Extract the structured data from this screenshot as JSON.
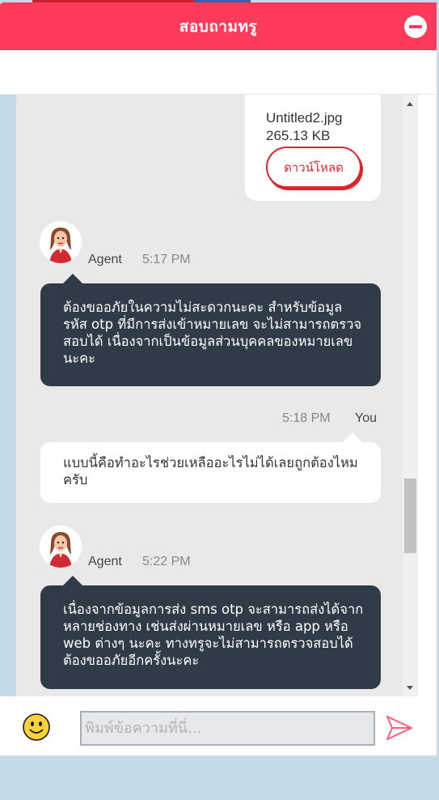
{
  "header": {
    "title": "สอบถามทรู"
  },
  "file": {
    "name": "Untitled2.jpg",
    "size": "265.13 KB",
    "download_label": "ดาวน์โหลด"
  },
  "messages": [
    {
      "sender": "Agent",
      "time": "5:17 PM",
      "text": "ต้องขออภัยในความไม่สะดวกนะคะ สำหรับข้อมูลรหัส otp ที่มีการส่งเข้าหมายเลข จะไม่สามารถตรวจสอบได้ เนื่องจากเป็นข้อมูลส่วนบุคคลของหมายเลขนะคะ"
    },
    {
      "sender": "You",
      "time": "5:18 PM",
      "text": "แบบนี้คือทำอะไรช่วยเหลืออะไรไม่ได้เลยถูกต้องไหมครับ"
    },
    {
      "sender": "Agent",
      "time": "5:22 PM",
      "text": "เนื่องจากข้อมูลการส่ง sms otp จะสามารถส่งได้จากหลายช่องทาง เช่นส่งผ่านหมายเลข หรือ app หรือ web ต่างๆ นะคะ ทางทรูจะไม่สามารถตรวจสอบได้ต้องขออภัยอีกครั้งนะคะ"
    }
  ],
  "composer": {
    "placeholder": "พิมพ์ข้อความที่นี่..."
  },
  "colors": {
    "header": "#ff3b5c",
    "agent_bubble": "#2f3b47",
    "accent": "#e0242f"
  },
  "icons": {
    "minimize": "minimize-icon",
    "emoji": "smiley-icon",
    "send": "send-icon"
  }
}
